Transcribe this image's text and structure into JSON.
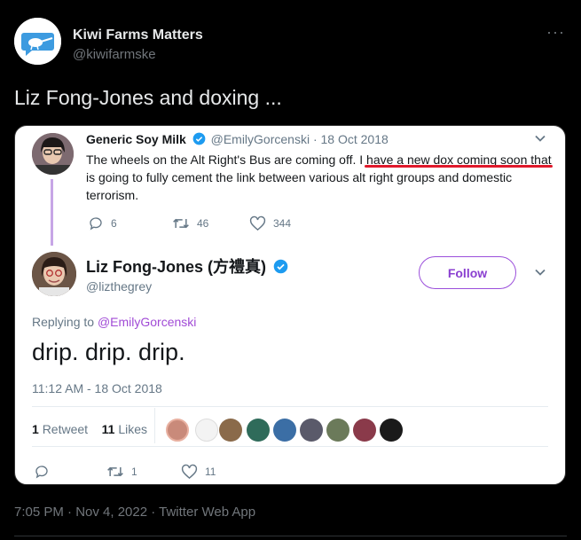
{
  "outer": {
    "name": "Kiwi Farms Matters",
    "handle": "@kiwifarmske",
    "more_label": "···",
    "text": "Liz Fong-Jones and doxing ...",
    "meta": "7:05 PM · Nov 4, 2022 · Twitter Web App"
  },
  "quoted": {
    "name": "Generic Soy Milk",
    "handle": "@EmilyGorcenski",
    "sep": "·",
    "date": "18 Oct 2018",
    "body_line1_pre": "The wheels on the Alt Right's Bus are coming off. ",
    "body_line1_highlight": "I have a new dox coming soon",
    "body_rest": "that is going to fully cement the link between various alt right groups and domestic terrorism.",
    "replies": "6",
    "retweets": "46",
    "likes": "344"
  },
  "main": {
    "name": "Liz Fong-Jones (方禮真)",
    "handle": "@lizthegrey",
    "follow_label": "Follow",
    "replying_prefix": "Replying to ",
    "replying_mention": "@EmilyGorcenski",
    "text": "drip. drip. drip.",
    "time": "11:12 AM - 18 Oct 2018",
    "retweet_count": "1",
    "retweet_label": "Retweet",
    "like_count": "11",
    "like_label": "Likes",
    "reply_count": "",
    "action_retweets": "1",
    "action_likes": "11"
  },
  "colors": {
    "accent_purple": "#8a3fd0",
    "verified_blue": "#1d9bf0",
    "highlight_red": "#e0192b"
  }
}
